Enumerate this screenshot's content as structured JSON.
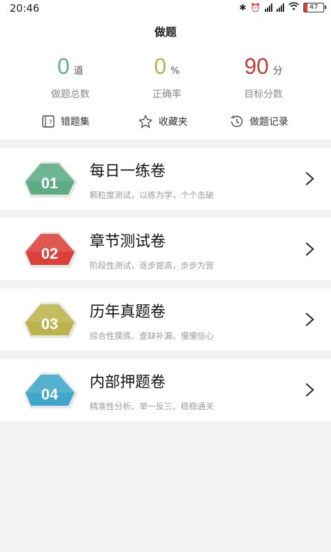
{
  "status_bar": {
    "time": "20:46",
    "battery": "47"
  },
  "header": {
    "title": "做题"
  },
  "stats": [
    {
      "value": "0",
      "unit": "道",
      "label": "做题总数",
      "color": "#5fae8e"
    },
    {
      "value": "0",
      "unit": "%",
      "label": "正确率",
      "color": "#b7ae56"
    },
    {
      "value": "90",
      "unit": "分",
      "label": "目标分数",
      "color": "#c1403a"
    }
  ],
  "quick_links": [
    {
      "label": "错题集",
      "icon": "error-book-icon"
    },
    {
      "label": "收藏夹",
      "icon": "star-icon"
    },
    {
      "label": "做题记录",
      "icon": "history-icon"
    }
  ],
  "cards": [
    {
      "number": "01",
      "title": "每日一练卷",
      "subtitle": "颗粒度测试，以练为学，个个击破",
      "color": "#5dab84"
    },
    {
      "number": "02",
      "title": "章节测试卷",
      "subtitle": "阶段性测试，逐步提高，步步为营",
      "color": "#d9413a"
    },
    {
      "number": "03",
      "title": "历年真题卷",
      "subtitle": "综合性摸底、查缺补漏、慢慢信心",
      "color": "#bbb44c"
    },
    {
      "number": "04",
      "title": "内部押题卷",
      "subtitle": "精准性分析、举一反三、稳稳通关",
      "color": "#3fa7c9"
    }
  ]
}
